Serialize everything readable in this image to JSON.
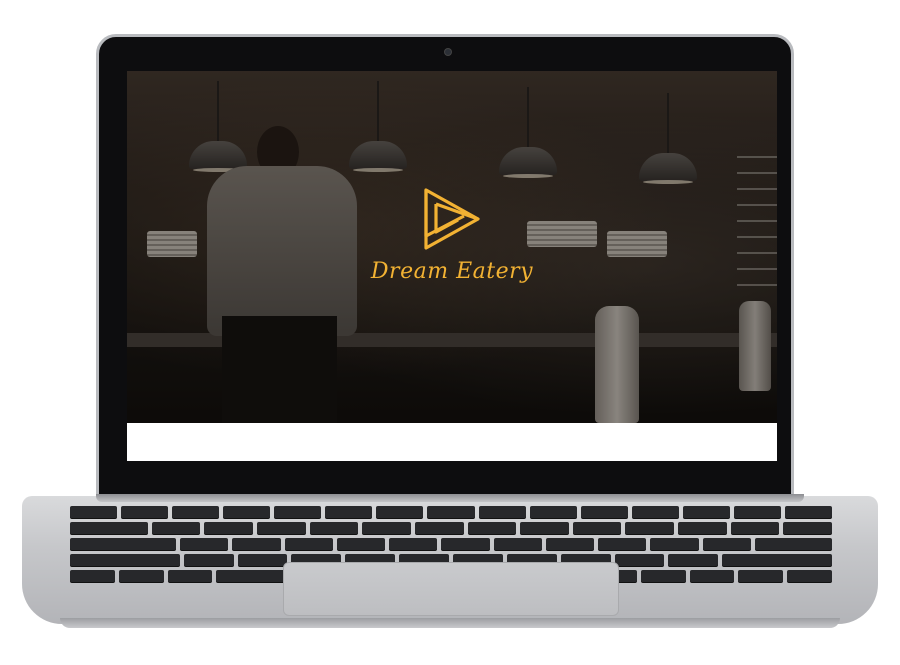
{
  "site": {
    "brand_name": "Dream Eatery",
    "logo_icon": "triangle-play-logo-icon",
    "accent_color": "#f2b233"
  },
  "device": {
    "type": "laptop",
    "icons": {
      "camera": "camera-icon"
    }
  }
}
